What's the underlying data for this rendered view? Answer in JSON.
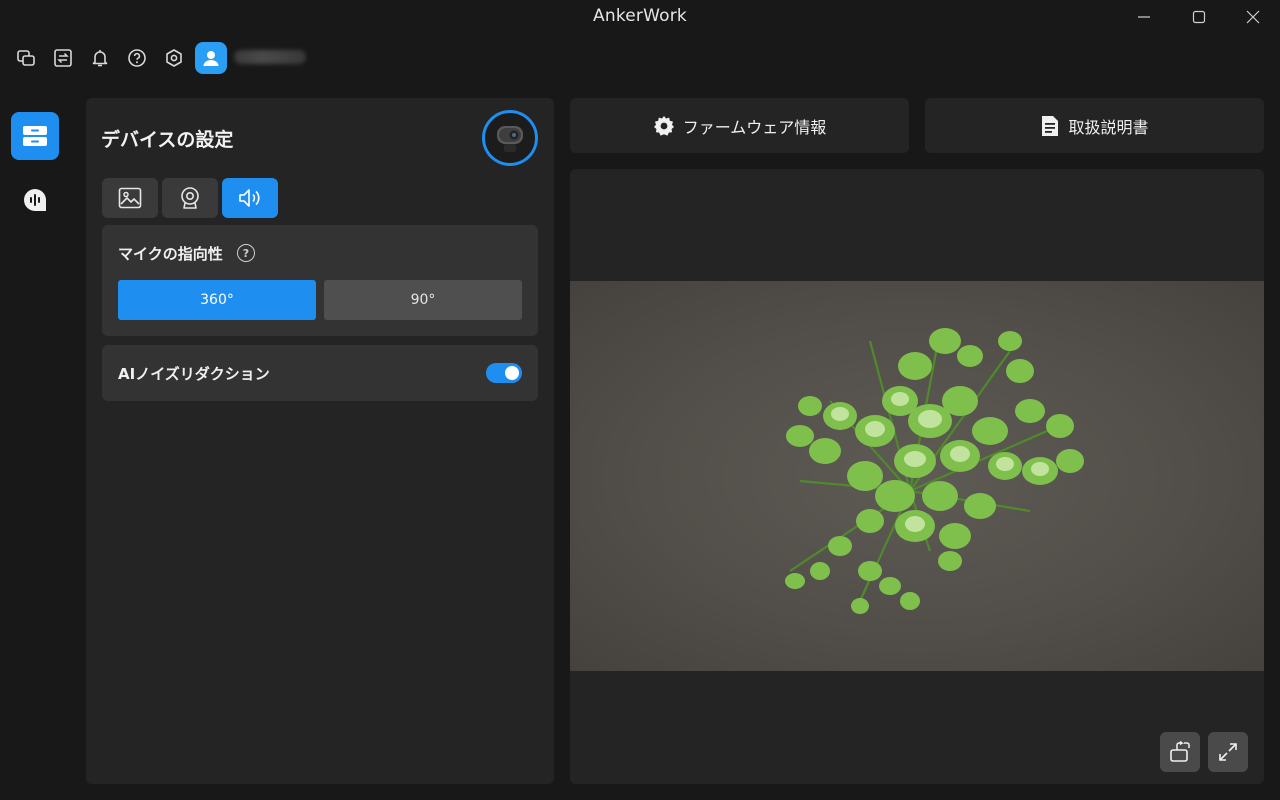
{
  "window": {
    "title": "AnkerWork",
    "controls": [
      "minimize-icon",
      "maximize-icon",
      "close-icon"
    ]
  },
  "toolbar": {
    "icons": [
      "multi-window-icon",
      "switch-icon",
      "bell-icon",
      "help-icon",
      "settings-hex-icon",
      "user-avatar-icon"
    ]
  },
  "nav": {
    "items": [
      {
        "icon": "device-icon",
        "active": true
      },
      {
        "icon": "voice-icon",
        "active": false
      }
    ]
  },
  "device_panel": {
    "title": "デバイスの設定",
    "tabs": [
      {
        "icon": "image-icon",
        "active": false
      },
      {
        "icon": "webcam-icon",
        "active": false
      },
      {
        "icon": "speaker-icon",
        "active": true
      }
    ],
    "mic_directivity": {
      "label": "マイクの指向性",
      "help": "?",
      "options": [
        "360°",
        "90°"
      ],
      "selected": "360°"
    },
    "ai_noise_reduction": {
      "label": "AIノイズリダクション",
      "enabled": true
    }
  },
  "header_buttons": {
    "firmware": "ファームウェア情報",
    "manual": "取扱説明書"
  },
  "preview": {
    "actions": [
      "rotate-icon",
      "fullscreen-icon"
    ]
  },
  "colors": {
    "accent": "#1f8ef1",
    "background": "#181818",
    "panel": "#242424",
    "card": "#333333"
  }
}
